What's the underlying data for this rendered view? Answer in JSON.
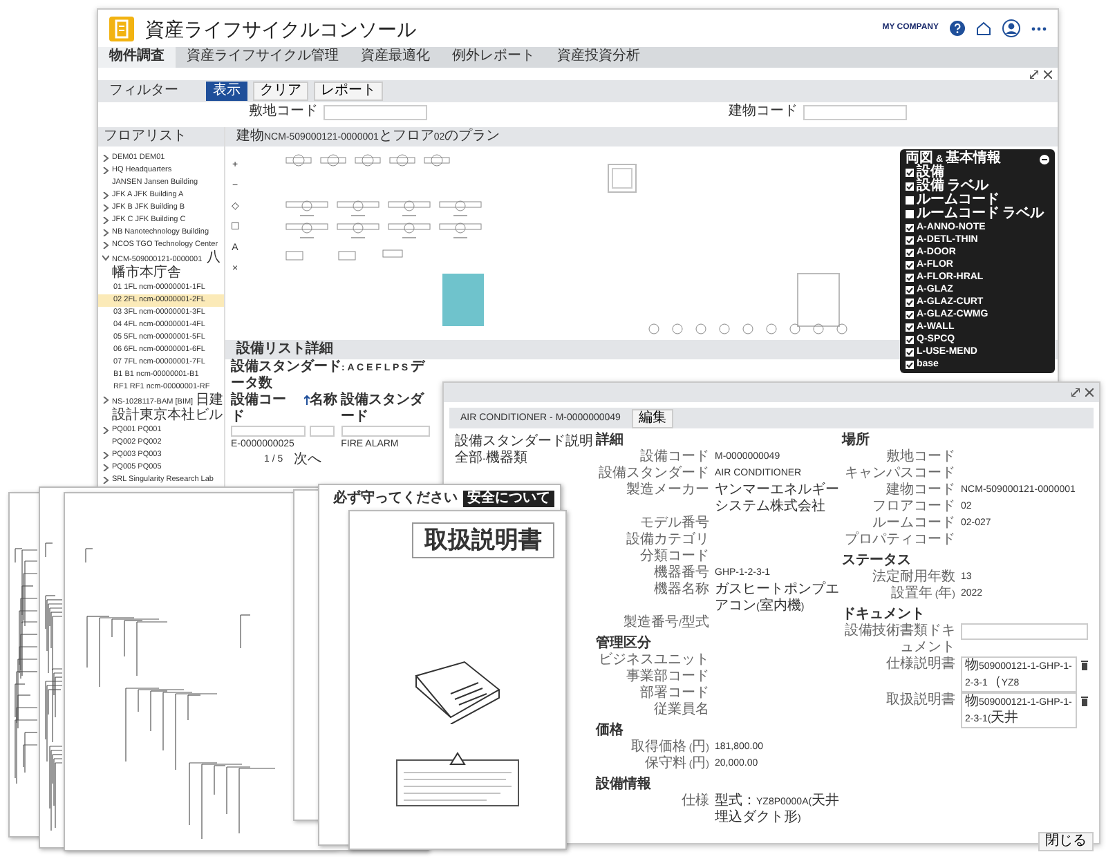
{
  "app": {
    "title": "資産ライフサイクルコンソール",
    "company": "MY COMPANY",
    "tabs": [
      {
        "label": "物件調査",
        "selected": true
      },
      {
        "label": "資産ライフサイクル管理",
        "selected": false
      },
      {
        "label": "資産最適化",
        "selected": false
      },
      {
        "label": "例外レポート",
        "selected": false
      },
      {
        "label": "資産投資分析",
        "selected": false
      }
    ]
  },
  "filter": {
    "label": "フィルター",
    "buttons": [
      {
        "label": "表示",
        "primary": true
      },
      {
        "label": "クリア",
        "primary": false
      },
      {
        "label": "レポート",
        "primary": false
      }
    ],
    "fields": [
      {
        "label": "敷地コード"
      },
      {
        "label": "建物コード"
      }
    ]
  },
  "floor_list": {
    "title": "フロアリスト",
    "items": [
      {
        "label": "DEM01 DEM01",
        "kind": "folder",
        "expanded": false
      },
      {
        "label": "HQ Headquarters",
        "kind": "folder",
        "expanded": false
      },
      {
        "label": "JANSEN Jansen Building",
        "kind": "leaf"
      },
      {
        "label": "JFK A JFK Building A",
        "kind": "folder",
        "expanded": false
      },
      {
        "label": "JFK B JFK Building B",
        "kind": "folder",
        "expanded": false
      },
      {
        "label": "JFK C JFK Building C",
        "kind": "folder",
        "expanded": false
      },
      {
        "label": "NB Nanotechnology Building",
        "kind": "folder",
        "expanded": false
      },
      {
        "label": "NCOS TGO Technology Center",
        "kind": "folder",
        "expanded": false
      },
      {
        "label": "NCM-509000121-0000001 八幡市本庁舎",
        "kind": "folder",
        "expanded": true,
        "children": [
          {
            "label": "01 1FL ncm-00000001-1FL",
            "selected": false
          },
          {
            "label": "02 2FL ncm-00000001-2FL",
            "selected": true
          },
          {
            "label": "03 3FL ncm-00000001-3FL",
            "selected": false
          },
          {
            "label": "04 4FL ncm-00000001-4FL",
            "selected": false
          },
          {
            "label": "05 5FL ncm-00000001-5FL",
            "selected": false
          },
          {
            "label": "06 6FL ncm-00000001-6FL",
            "selected": false
          },
          {
            "label": "07 7FL ncm-00000001-7FL",
            "selected": false
          },
          {
            "label": "B1 B1 ncm-00000001-B1",
            "selected": false
          },
          {
            "label": "RF1 RF1 ncm-00000001-RF",
            "selected": false
          }
        ]
      },
      {
        "label": "NS-1028117-BAM [BIM]日建設計東京本社ビル",
        "kind": "folder",
        "expanded": false
      },
      {
        "label": "PQ001 PQ001",
        "kind": "folder",
        "expanded": false
      },
      {
        "label": "PQ002 PQ002",
        "kind": "leaf"
      },
      {
        "label": "PQ003 PQ003",
        "kind": "folder",
        "expanded": false
      },
      {
        "label": "PQ005 PQ005",
        "kind": "folder",
        "expanded": false
      },
      {
        "label": "SRL Singularity Research Lab",
        "kind": "folder",
        "expanded": false
      }
    ]
  },
  "plan": {
    "title": "建物NCM-509000121-0000001とフロア02のプラン",
    "tools": [
      "+",
      "−",
      "◇",
      "☐",
      "A",
      "×"
    ],
    "layers": {
      "title": "両図 & 基本情報",
      "items": [
        {
          "label": "設備",
          "checked": true
        },
        {
          "label": "設備 ラベル",
          "checked": true
        },
        {
          "label": "ルームコード",
          "checked": false
        },
        {
          "label": "ルームコード ラベル",
          "checked": false
        },
        {
          "label": "A-ANNO-NOTE",
          "checked": true
        },
        {
          "label": "A-DETL-THIN",
          "checked": true
        },
        {
          "label": "A-DOOR",
          "checked": true
        },
        {
          "label": "A-FLOR",
          "checked": true
        },
        {
          "label": "A-FLOR-HRAL",
          "checked": true
        },
        {
          "label": "A-GLAZ",
          "checked": true
        },
        {
          "label": "A-GLAZ-CURT",
          "checked": true
        },
        {
          "label": "A-GLAZ-CWMG",
          "checked": true
        },
        {
          "label": "A-WALL",
          "checked": true
        },
        {
          "label": "Q-SPCQ",
          "checked": true
        },
        {
          "label": "L-USE-MEND",
          "checked": true
        },
        {
          "label": "base",
          "checked": true
        }
      ]
    }
  },
  "equipment_list": {
    "title": "設備リスト詳細",
    "summary": "設備スタンダード: A C E F L P S データ数",
    "columns": [
      "設備コード",
      "名称",
      "設備スタンダード"
    ],
    "rows": [
      [
        "E-0000000025",
        "",
        "FIRE ALARM"
      ]
    ],
    "pager": "1 / 5",
    "next": "次へ"
  },
  "detail": {
    "title": "AIR CONDITIONER - M-0000000049",
    "edit": "編集",
    "side": [
      "設備スタンダード説明",
      "全部-機器類"
    ],
    "columns": [
      {
        "sections": [
          {
            "title": "詳細",
            "rows": [
              {
                "label": "設備コード",
                "value": "M-0000000049"
              },
              {
                "label": "設備スタンダード",
                "value": "AIR CONDITIONER"
              },
              {
                "label": "製造メーカー",
                "value": "ヤンマーエネルギーシステム株式会社"
              },
              {
                "label": "モデル番号"
              },
              {
                "label": "設備カテゴリ"
              },
              {
                "label": "分類コード"
              },
              {
                "label": "機器番号",
                "value": "GHP-1-2-3-1"
              },
              {
                "label": "機器名称",
                "value": "ガスヒートポンプエアコン(室内機)"
              },
              {
                "label": "製造番号/型式"
              }
            ]
          },
          {
            "title": "管理区分",
            "rows": [
              {
                "label": "ビジネスユニット"
              },
              {
                "label": "事業部コード"
              },
              {
                "label": "部署コード"
              },
              {
                "label": "従業員名"
              }
            ]
          },
          {
            "title": "価格",
            "rows": [
              {
                "label": "取得価格 (円)",
                "value": "181,800.00"
              },
              {
                "label": "保守料 (円)",
                "value": "20,000.00"
              }
            ]
          },
          {
            "title": "設備情報",
            "rows": [
              {
                "label": "仕様",
                "value": "型式：YZ8P0000A(天井埋込ダクト形)"
              }
            ]
          }
        ]
      },
      {
        "sections": [
          {
            "title": "場所",
            "rows": [
              {
                "label": "敷地コード"
              },
              {
                "label": "キャンパスコード"
              },
              {
                "label": "建物コード",
                "value": "NCM-509000121-0000001"
              },
              {
                "label": "フロアコード",
                "value": "02"
              },
              {
                "label": "ルームコード",
                "value": "02-027"
              },
              {
                "label": "プロパティコード"
              }
            ]
          },
          {
            "title": "ステータス",
            "rows": [
              {
                "label": "法定耐用年数",
                "value": "13"
              },
              {
                "label": "設置年 (年)",
                "value": "2022"
              }
            ]
          },
          {
            "title": "ドキュメント",
            "rows": [
              {
                "label": "設備技術書類ドキュメント",
                "kind": "field"
              },
              {
                "label": "仕様説明書",
                "kind": "file",
                "value": "物509000121-1-GHP-1-2-3-1（YZ8"
              },
              {
                "label": "取扱説明書",
                "kind": "file",
                "value": "物509000121-1-GHP-1-2-3-1(天井"
              }
            ]
          }
        ]
      }
    ],
    "close": "閉じる"
  },
  "documents": [
    {
      "kind": "schematic"
    },
    {
      "kind": "schematic"
    },
    {
      "kind": "schematic"
    },
    {
      "kind": "blank"
    },
    {
      "kind": "safety",
      "header": "必ず守ってください",
      "banner": "安全について"
    },
    {
      "kind": "cover",
      "title": "取扱説明書"
    }
  ]
}
